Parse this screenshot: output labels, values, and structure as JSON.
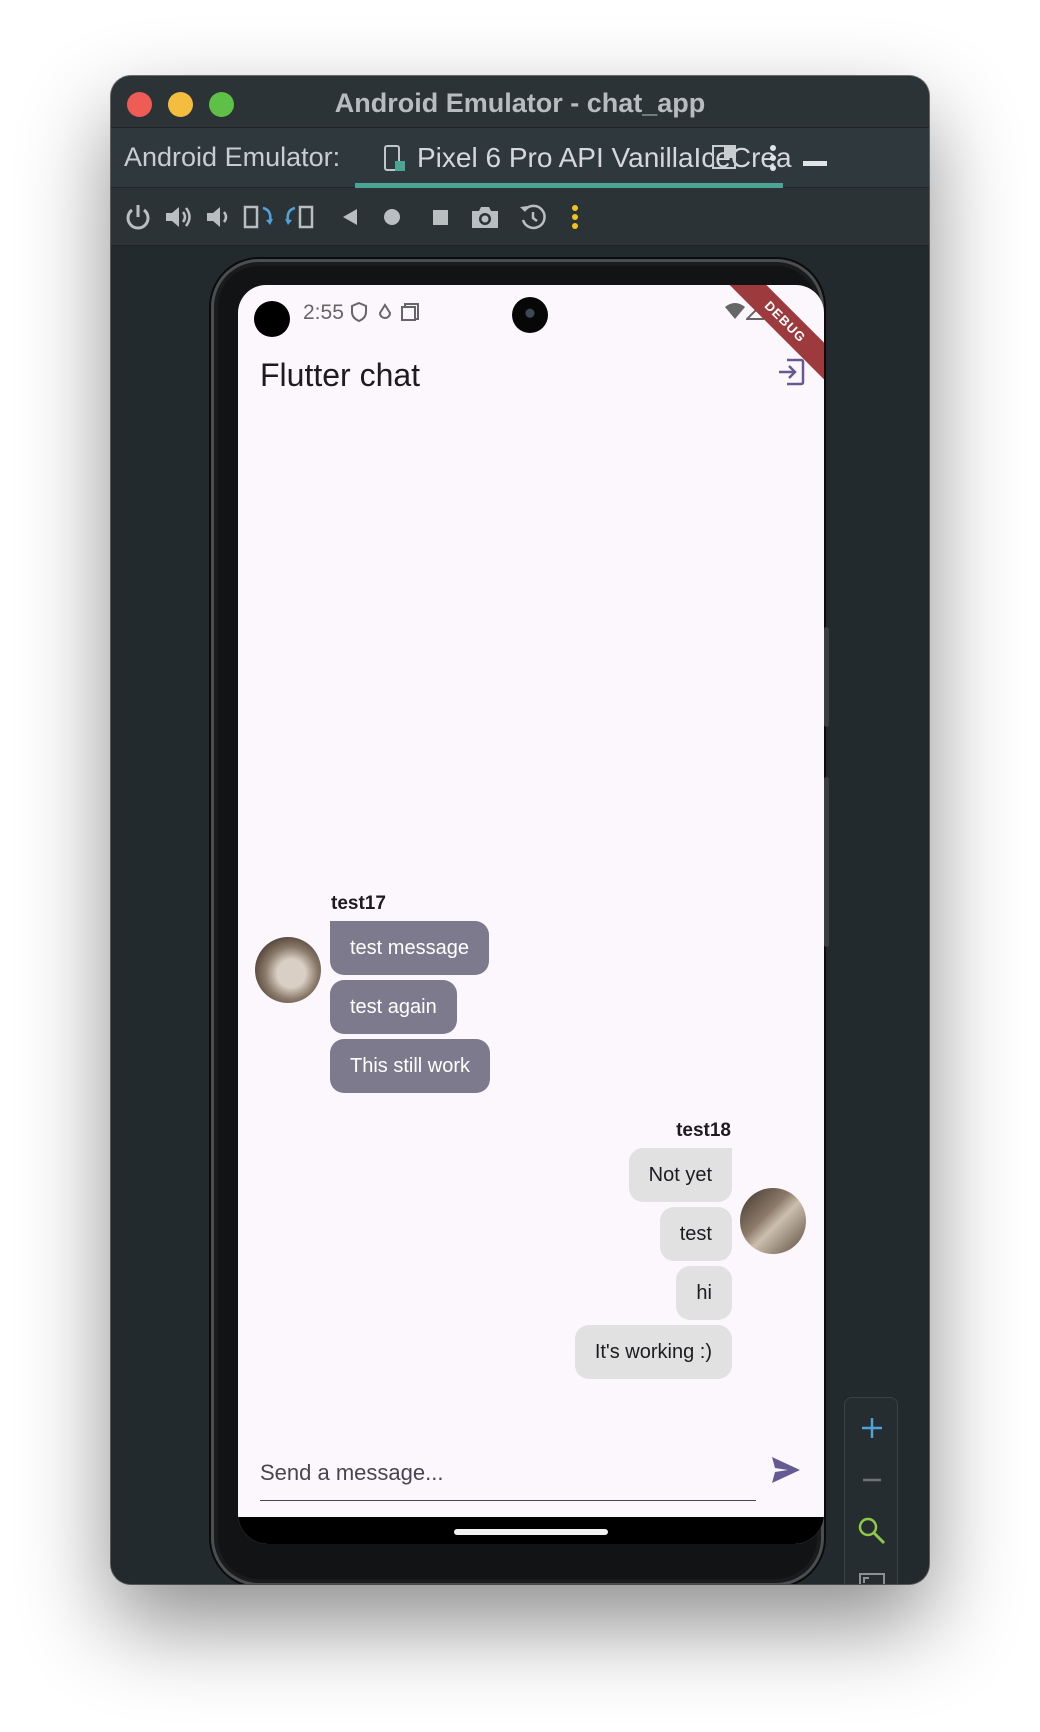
{
  "window": {
    "title": "Android Emulator - chat_app"
  },
  "tabbar": {
    "label": "Android Emulator:",
    "device_tab": "Pixel 6 Pro API VanillaIceCrea"
  },
  "status_bar": {
    "time": "2:55"
  },
  "debug_banner": "DEBUG",
  "app": {
    "title": "Flutter chat"
  },
  "chat": {
    "groups": [
      {
        "username": "test17",
        "side": "left",
        "messages": [
          "test message",
          "test again",
          "This still work"
        ]
      },
      {
        "username": "test18",
        "side": "right",
        "messages": [
          "Not yet",
          "test",
          "hi",
          "It's working :)"
        ]
      }
    ]
  },
  "composer": {
    "placeholder": "Send a message..."
  },
  "colors": {
    "accent": "#4ba596",
    "their_bubble": "#7e7a8e",
    "my_bubble": "#e1e1e1",
    "app_background": "#fcf7fc",
    "primary_icon": "#655b93"
  },
  "icons": {
    "logout": "exit-to-app-icon",
    "send": "send-icon"
  }
}
